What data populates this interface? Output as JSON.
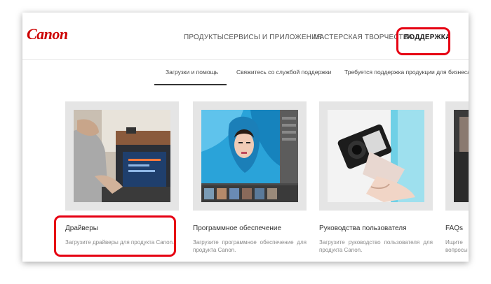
{
  "brand": {
    "logo": "Canon"
  },
  "nav": {
    "items": [
      "ПРОДУКТЫ",
      "СЕРВИСЫ И ПРИЛОЖЕНИЯ",
      "МАСТЕРСКАЯ ТВОРЧЕСТВА",
      "ПОДДЕРЖКА"
    ],
    "active": "ПОДДЕРЖКА"
  },
  "subnav": {
    "items": [
      "Загрузки и помощь",
      "Свяжитесь со службой поддержки",
      "Требуется поддержка продукции для бизнеса"
    ],
    "active": "Загрузки и помощь"
  },
  "cards": [
    {
      "title": "Драйверы",
      "desc": "Загрузите драйверы для продукта Canon."
    },
    {
      "title": "Программное обеспечение",
      "desc": "Загрузите программное обеспечение для продукта Canon."
    },
    {
      "title": "Руководства пользователя",
      "desc": "Загрузите руководство пользователя для продукта Canon."
    },
    {
      "title": "FAQs",
      "desc": "Ищите вопросы"
    }
  ],
  "colors": {
    "highlight": "#e60012",
    "brand": "#cc0000"
  }
}
